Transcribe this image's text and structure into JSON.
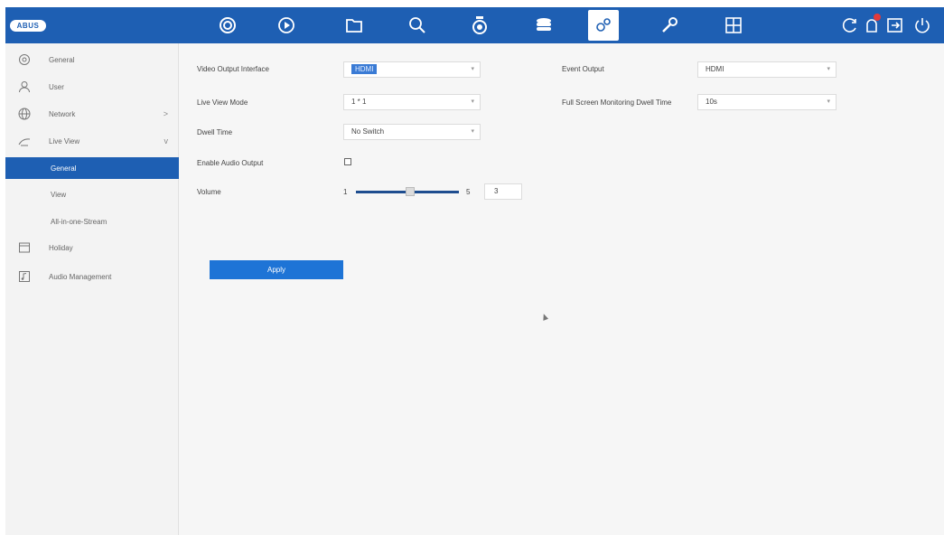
{
  "header": {
    "logo": "ABUS",
    "nav_icons": [
      "live-view-icon",
      "playback-icon",
      "file-icon",
      "search-icon",
      "camera-icon",
      "storage-icon",
      "configuration-icon",
      "maintenance-icon",
      "layout-icon"
    ],
    "right_icons": [
      "refresh-icon",
      "alarm-icon",
      "logout-icon",
      "power-icon"
    ],
    "active_icon": "configuration-icon",
    "accent": "#1e5fb3"
  },
  "sidebar": {
    "items": [
      {
        "label": "General",
        "icon": "gear-icon"
      },
      {
        "label": "User",
        "icon": "user-icon"
      },
      {
        "label": "Network",
        "icon": "globe-icon",
        "chevron": ">"
      },
      {
        "label": "Live View",
        "icon": "live-view-icon",
        "chevron": "v"
      },
      {
        "label": "General",
        "sub": true,
        "selected": true
      },
      {
        "label": "View",
        "sub": true
      },
      {
        "label": "All-in-one-Stream",
        "sub": true
      },
      {
        "label": "Holiday",
        "icon": "calendar-icon"
      },
      {
        "label": "Audio Management",
        "icon": "audio-icon"
      }
    ]
  },
  "form": {
    "video_output_label": "Video Output Interface",
    "video_output_value": "HDMI",
    "live_view_mode_label": "Live View Mode",
    "live_view_mode_value": "1 * 1",
    "dwell_time_label": "Dwell Time",
    "dwell_time_value": "No Switch",
    "enable_audio_label": "Enable Audio Output",
    "enable_audio_checked": false,
    "volume_label": "Volume",
    "volume_min": "1",
    "volume_max": "5",
    "volume_value": "3",
    "event_output_label": "Event Output",
    "event_output_value": "HDMI",
    "full_screen_label": "Full Screen Monitoring Dwell Time",
    "full_screen_value": "10s",
    "apply_label": "Apply"
  }
}
